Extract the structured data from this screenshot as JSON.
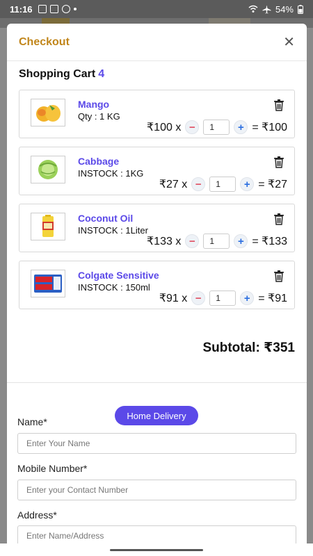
{
  "status_bar": {
    "time": "11:16",
    "battery": "54%"
  },
  "modal": {
    "title": "Checkout",
    "close_label": "✕"
  },
  "cart": {
    "heading": "Shopping Cart",
    "count": "4",
    "items": [
      {
        "name": "Mango",
        "stock": "Qty : 1 KG",
        "price": "₹100 x",
        "qty": "1",
        "total": "= ₹100",
        "icon": "mango-image"
      },
      {
        "name": "Cabbage",
        "stock": "INSTOCK : 1KG",
        "price": "₹27 x",
        "qty": "1",
        "total": "= ₹27",
        "icon": "cabbage-image"
      },
      {
        "name": "Coconut Oil",
        "stock": "INSTOCK : 1Liter",
        "price": "₹133 x",
        "qty": "1",
        "total": "= ₹133",
        "icon": "coconut-oil-image"
      },
      {
        "name": "Colgate Sensitive",
        "stock": "INSTOCK : 150ml",
        "price": "₹91 x",
        "qty": "1",
        "total": "= ₹91",
        "icon": "colgate-image"
      }
    ],
    "minus_symbol": "−",
    "plus_symbol": "+",
    "subtotal": "Subtotal: ₹351"
  },
  "delivery": {
    "button_label": "Home Delivery"
  },
  "form": {
    "name_label": "Name*",
    "name_placeholder": "Enter Your Name",
    "mobile_label": "Mobile Number*",
    "mobile_placeholder": "Enter your Contact Number",
    "address_label": "Address*",
    "address_placeholder": "Enter Name/Address"
  },
  "colors": {
    "accent": "#5b49e8",
    "title": "#c1861b",
    "minus": "#e04f62",
    "plus": "#2a6de0"
  }
}
